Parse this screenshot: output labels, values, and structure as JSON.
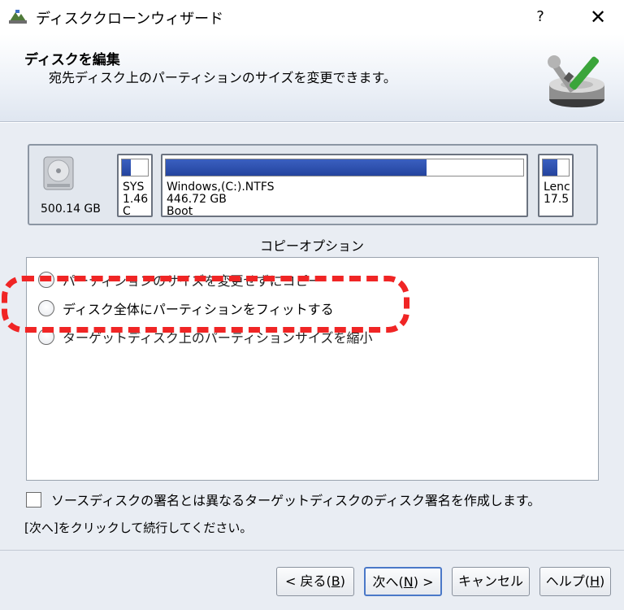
{
  "window": {
    "title": "ディスククローンウィザード",
    "help_label": "?",
    "close_label": "✕"
  },
  "header": {
    "title": "ディスクを編集",
    "subtitle": "宛先ディスク上のパーティションのサイズを変更できます。"
  },
  "disk": {
    "size": "500.14 GB",
    "partitions": [
      {
        "name": "SYS",
        "size": "1.46",
        "used_fraction": 0.35,
        "extra": "C"
      },
      {
        "name": "Windows,(C:).NTFS",
        "size": "446.72 GB",
        "used_fraction": 0.73,
        "extra": "Boot"
      },
      {
        "name": "Lenc",
        "size": "17.5",
        "used_fraction": 0.55,
        "extra": ""
      }
    ]
  },
  "copy_options": {
    "label": "コピーオプション",
    "options": [
      {
        "label": "パーティションのサイズを変更せずにコピー",
        "selected": false
      },
      {
        "label": "ディスク全体にパーティションをフィットする",
        "selected": false
      },
      {
        "label": "ターゲットディスク上のパーティションサイズを縮小",
        "selected": false
      }
    ]
  },
  "signature_checkbox": {
    "label": "ソースディスクの署名とは異なるターゲットディスクのディスク署名を作成します。",
    "checked": false
  },
  "hint_text": "[次へ]をクリックして続行してください。",
  "buttons": {
    "back": {
      "text": "< 戻る(",
      "key": "B",
      "suffix": ")"
    },
    "next": {
      "text": "次へ(",
      "key": "N",
      "suffix": ") >"
    },
    "cancel": "キャンセル",
    "help": {
      "text": "ヘルプ(",
      "key": "H",
      "suffix": ")"
    }
  },
  "colors": {
    "partition_fill": "#2e4fae",
    "highlight": "#f02525",
    "panel_bg": "#e9edf3"
  }
}
